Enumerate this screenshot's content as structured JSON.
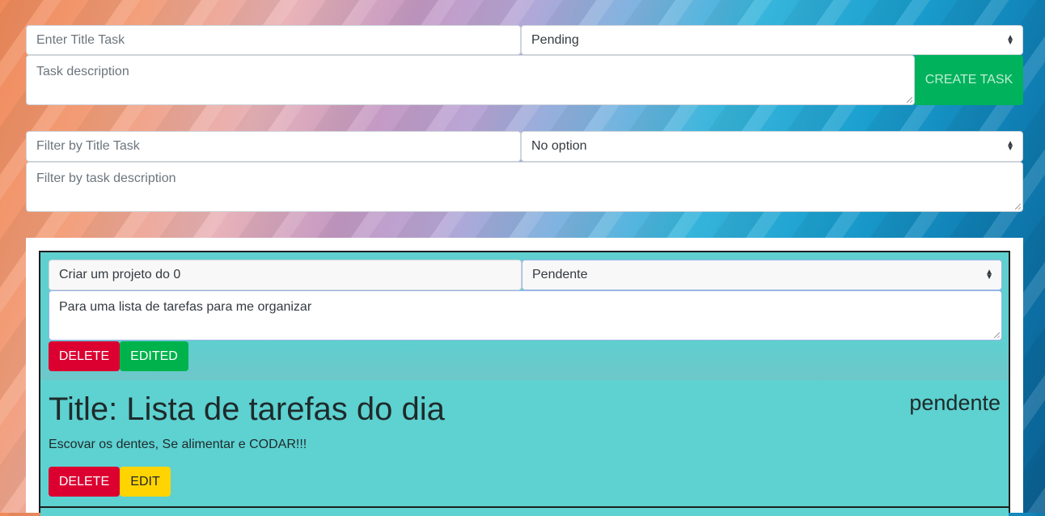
{
  "create_form": {
    "title_placeholder": "Enter Title Task",
    "status_selected": "Pending",
    "description_placeholder": "Task description",
    "create_button": "CREATE TASK"
  },
  "filter_form": {
    "title_placeholder": "Filter by Title Task",
    "status_selected": "No option",
    "description_placeholder": "Filter by task description"
  },
  "tasks": [
    {
      "mode": "edit",
      "title_value": "Criar um projeto do 0",
      "status_selected": "Pendente",
      "description_value": "Para uma lista de tarefas para me organizar",
      "delete_label": "DELETE",
      "edited_label": "EDITED"
    },
    {
      "mode": "view",
      "title": "Title: Lista de tarefas do dia",
      "status": "pendente",
      "description": "Escovar os dentes, Se alimentar e CODAR!!!",
      "delete_label": "DELETE",
      "edit_label": "EDIT"
    }
  ],
  "colors": {
    "create_button": "#00b25c",
    "delete_button": "#dc0030",
    "edited_button": "#00b24c",
    "edit_button": "#ffd400",
    "card_background": "#5ed1d1"
  }
}
